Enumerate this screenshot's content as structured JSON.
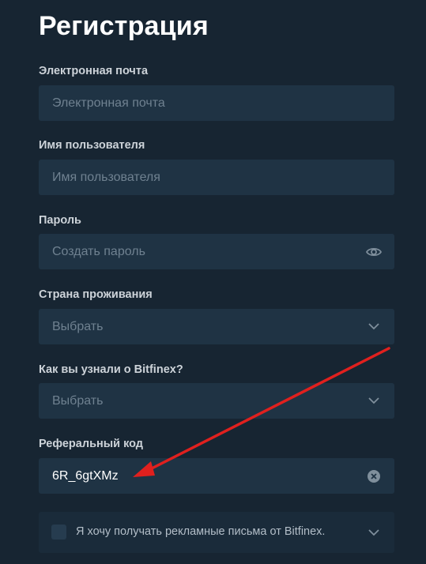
{
  "page": {
    "title": "Регистрация"
  },
  "email": {
    "label": "Электронная почта",
    "placeholder": "Электронная почта"
  },
  "username": {
    "label": "Имя пользователя",
    "placeholder": "Имя пользователя"
  },
  "password": {
    "label": "Пароль",
    "placeholder": "Создать пароль",
    "icon": "eye-icon"
  },
  "country": {
    "label": "Страна проживания",
    "value": "Выбрать",
    "icon": "chevron-down-icon"
  },
  "source": {
    "label": "Как вы узнали о Bitfinex?",
    "value": "Выбрать",
    "icon": "chevron-down-icon"
  },
  "referral": {
    "label": "Реферальный код",
    "value": "6R_6gtXMz",
    "icon": "clear-icon"
  },
  "consent": {
    "text": "Я хочу получать рекламные письма от Bitfinex.",
    "checked": false,
    "icon": "chevron-down-icon"
  },
  "colors": {
    "background": "#172532",
    "field": "#1f3344",
    "arrow": "#e0201e"
  }
}
